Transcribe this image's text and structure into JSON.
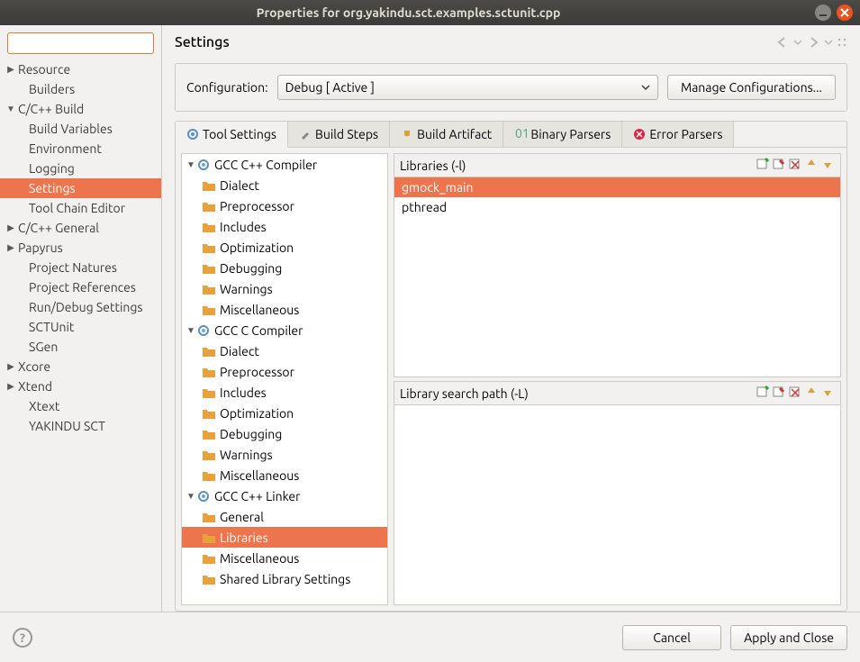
{
  "window": {
    "title": "Properties for org.yakindu.sct.examples.sctunit.cpp"
  },
  "sidebar": {
    "filter_placeholder": "",
    "items": [
      {
        "label": "Resource",
        "arrow": "▶",
        "indent": 0
      },
      {
        "label": "Builders",
        "arrow": "",
        "indent": 1
      },
      {
        "label": "C/C++ Build",
        "arrow": "▼",
        "indent": 0
      },
      {
        "label": "Build Variables",
        "arrow": "",
        "indent": 1
      },
      {
        "label": "Environment",
        "arrow": "",
        "indent": 1
      },
      {
        "label": "Logging",
        "arrow": "",
        "indent": 1
      },
      {
        "label": "Settings",
        "arrow": "",
        "indent": 1,
        "selected": true
      },
      {
        "label": "Tool Chain Editor",
        "arrow": "",
        "indent": 1
      },
      {
        "label": "C/C++ General",
        "arrow": "▶",
        "indent": 0
      },
      {
        "label": "Papyrus",
        "arrow": "▶",
        "indent": 0
      },
      {
        "label": "Project Natures",
        "arrow": "",
        "indent": 1
      },
      {
        "label": "Project References",
        "arrow": "",
        "indent": 1
      },
      {
        "label": "Run/Debug Settings",
        "arrow": "",
        "indent": 1
      },
      {
        "label": "SCTUnit",
        "arrow": "",
        "indent": 1
      },
      {
        "label": "SGen",
        "arrow": "",
        "indent": 1
      },
      {
        "label": "Xcore",
        "arrow": "▶",
        "indent": 0
      },
      {
        "label": "Xtend",
        "arrow": "▶",
        "indent": 0
      },
      {
        "label": "Xtext",
        "arrow": "",
        "indent": 1
      },
      {
        "label": "YAKINDU SCT",
        "arrow": "",
        "indent": 1
      }
    ]
  },
  "main": {
    "title": "Settings",
    "config_label": "Configuration:",
    "config_value": "Debug  [ Active ]",
    "manage_btn": "Manage Configurations...",
    "tabs": [
      {
        "label": "Tool Settings",
        "icon": "gear",
        "active": true
      },
      {
        "label": "Build Steps",
        "icon": "wrench"
      },
      {
        "label": "Build Artifact",
        "icon": "trophy"
      },
      {
        "label": "Binary Parsers",
        "icon": "binary"
      },
      {
        "label": "Error Parsers",
        "icon": "error"
      }
    ],
    "tree": [
      {
        "label": "GCC C++ Compiler",
        "arrow": "▼",
        "icon": "gear",
        "lvl": 0
      },
      {
        "label": "Dialect",
        "icon": "folder",
        "lvl": 1
      },
      {
        "label": "Preprocessor",
        "icon": "folder",
        "lvl": 1
      },
      {
        "label": "Includes",
        "icon": "folder",
        "lvl": 1
      },
      {
        "label": "Optimization",
        "icon": "folder",
        "lvl": 1
      },
      {
        "label": "Debugging",
        "icon": "folder",
        "lvl": 1
      },
      {
        "label": "Warnings",
        "icon": "folder",
        "lvl": 1
      },
      {
        "label": "Miscellaneous",
        "icon": "folder",
        "lvl": 1
      },
      {
        "label": "GCC C Compiler",
        "arrow": "▼",
        "icon": "gear",
        "lvl": 0
      },
      {
        "label": "Dialect",
        "icon": "folder",
        "lvl": 1
      },
      {
        "label": "Preprocessor",
        "icon": "folder",
        "lvl": 1
      },
      {
        "label": "Includes",
        "icon": "folder",
        "lvl": 1
      },
      {
        "label": "Optimization",
        "icon": "folder",
        "lvl": 1
      },
      {
        "label": "Debugging",
        "icon": "folder",
        "lvl": 1
      },
      {
        "label": "Warnings",
        "icon": "folder",
        "lvl": 1
      },
      {
        "label": "Miscellaneous",
        "icon": "folder",
        "lvl": 1
      },
      {
        "label": "GCC C++ Linker",
        "arrow": "▼",
        "icon": "gear",
        "lvl": 0
      },
      {
        "label": "General",
        "icon": "folder",
        "lvl": 1
      },
      {
        "label": "Libraries",
        "icon": "folder",
        "lvl": 1,
        "selected": true
      },
      {
        "label": "Miscellaneous",
        "icon": "folder",
        "lvl": 1
      },
      {
        "label": "Shared Library Settings",
        "icon": "folder",
        "lvl": 1
      }
    ],
    "libs": {
      "header": "Libraries (-l)",
      "items": [
        {
          "label": "gmock_main",
          "selected": true
        },
        {
          "label": "pthread"
        }
      ]
    },
    "libpath": {
      "header": "Library search path (-L)",
      "items": []
    }
  },
  "footer": {
    "cancel": "Cancel",
    "apply": "Apply and Close"
  }
}
